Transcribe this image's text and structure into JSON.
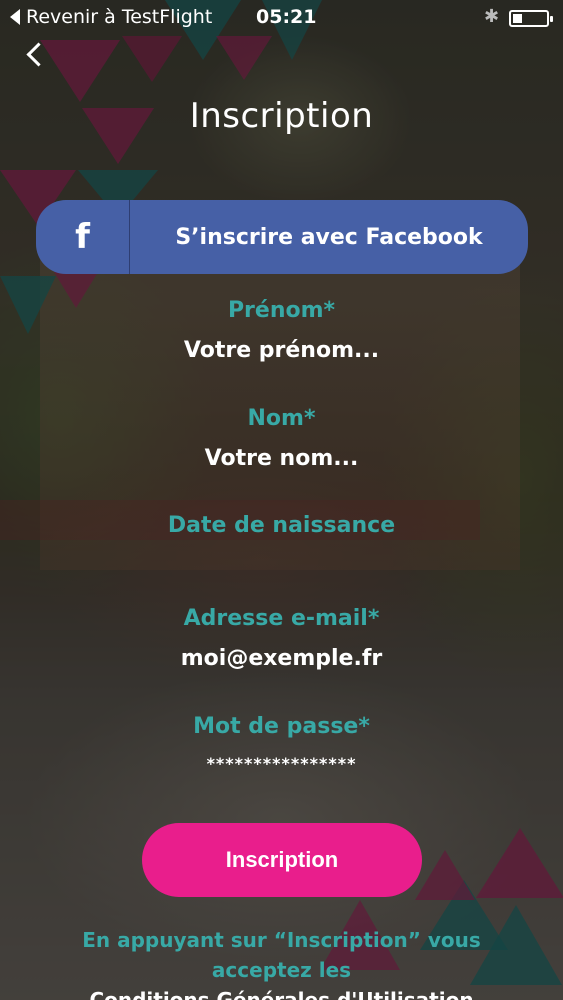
{
  "status_bar": {
    "back_app": "Revenir à TestFlight",
    "time": "05:21",
    "bluetooth_icon": "bluetooth-icon",
    "battery_icon": "battery-icon"
  },
  "nav": {
    "back_icon": "chevron-left-icon"
  },
  "title": "Inscription",
  "facebook": {
    "icon_glyph": "f",
    "label": "S’inscrire avec Facebook",
    "color": "#4660a6"
  },
  "form": {
    "first_name": {
      "label": "Prénom*",
      "value": "Votre prénom..."
    },
    "last_name": {
      "label": "Nom*",
      "value": "Votre nom..."
    },
    "birth_date": {
      "label": "Date de naissance",
      "value": ""
    },
    "email": {
      "label": "Adresse e-mail*",
      "value": "moi@exemple.fr"
    },
    "password": {
      "label": "Mot de passe*",
      "value": "****************"
    }
  },
  "submit_label": "Inscription",
  "submit_color": "#e91e8c",
  "accent_color": "#38a9a6",
  "legal": {
    "line1": "En appuyant sur “Inscription” vous",
    "line2": "acceptez les",
    "line3": "Conditions Générales d'Utilisation"
  }
}
